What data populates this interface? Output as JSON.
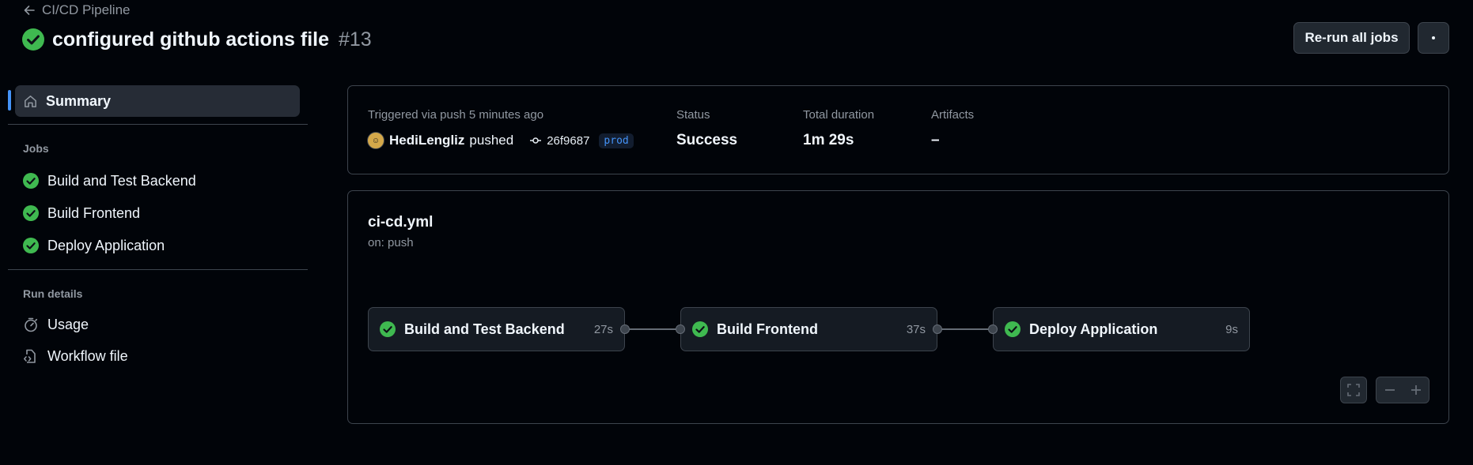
{
  "header": {
    "back_label": "CI/CD Pipeline",
    "title": "configured github actions file",
    "run_number": "#13",
    "rerun_label": "Re-run all jobs",
    "more_icon": "kebab-horizontal-icon"
  },
  "sidebar": {
    "summary_label": "Summary",
    "jobs_heading": "Jobs",
    "jobs": [
      {
        "label": "Build and Test Backend",
        "status": "success"
      },
      {
        "label": "Build Frontend",
        "status": "success"
      },
      {
        "label": "Deploy Application",
        "status": "success"
      }
    ],
    "run_details_heading": "Run details",
    "run_details": [
      {
        "label": "Usage",
        "icon": "stopwatch-icon"
      },
      {
        "label": "Workflow file",
        "icon": "file-code-icon"
      }
    ]
  },
  "summary": {
    "trigger_text": "Triggered via push 5 minutes ago",
    "actor": "HediLengliz",
    "action": "pushed",
    "commit_sha": "26f9687",
    "branch": "prod",
    "status_label": "Status",
    "status_value": "Success",
    "duration_label": "Total duration",
    "duration_value": "1m 29s",
    "artifacts_label": "Artifacts",
    "artifacts_value": "–"
  },
  "workflow": {
    "file": "ci-cd.yml",
    "trigger": "on: push",
    "jobs": [
      {
        "name": "Build and Test Backend",
        "duration": "27s"
      },
      {
        "name": "Build Frontend",
        "duration": "37s"
      },
      {
        "name": "Deploy Application",
        "duration": "9s"
      }
    ]
  },
  "colors": {
    "background": "#010409",
    "success": "#3fb950",
    "accent": "#4493f8",
    "border": "#3d444d"
  }
}
